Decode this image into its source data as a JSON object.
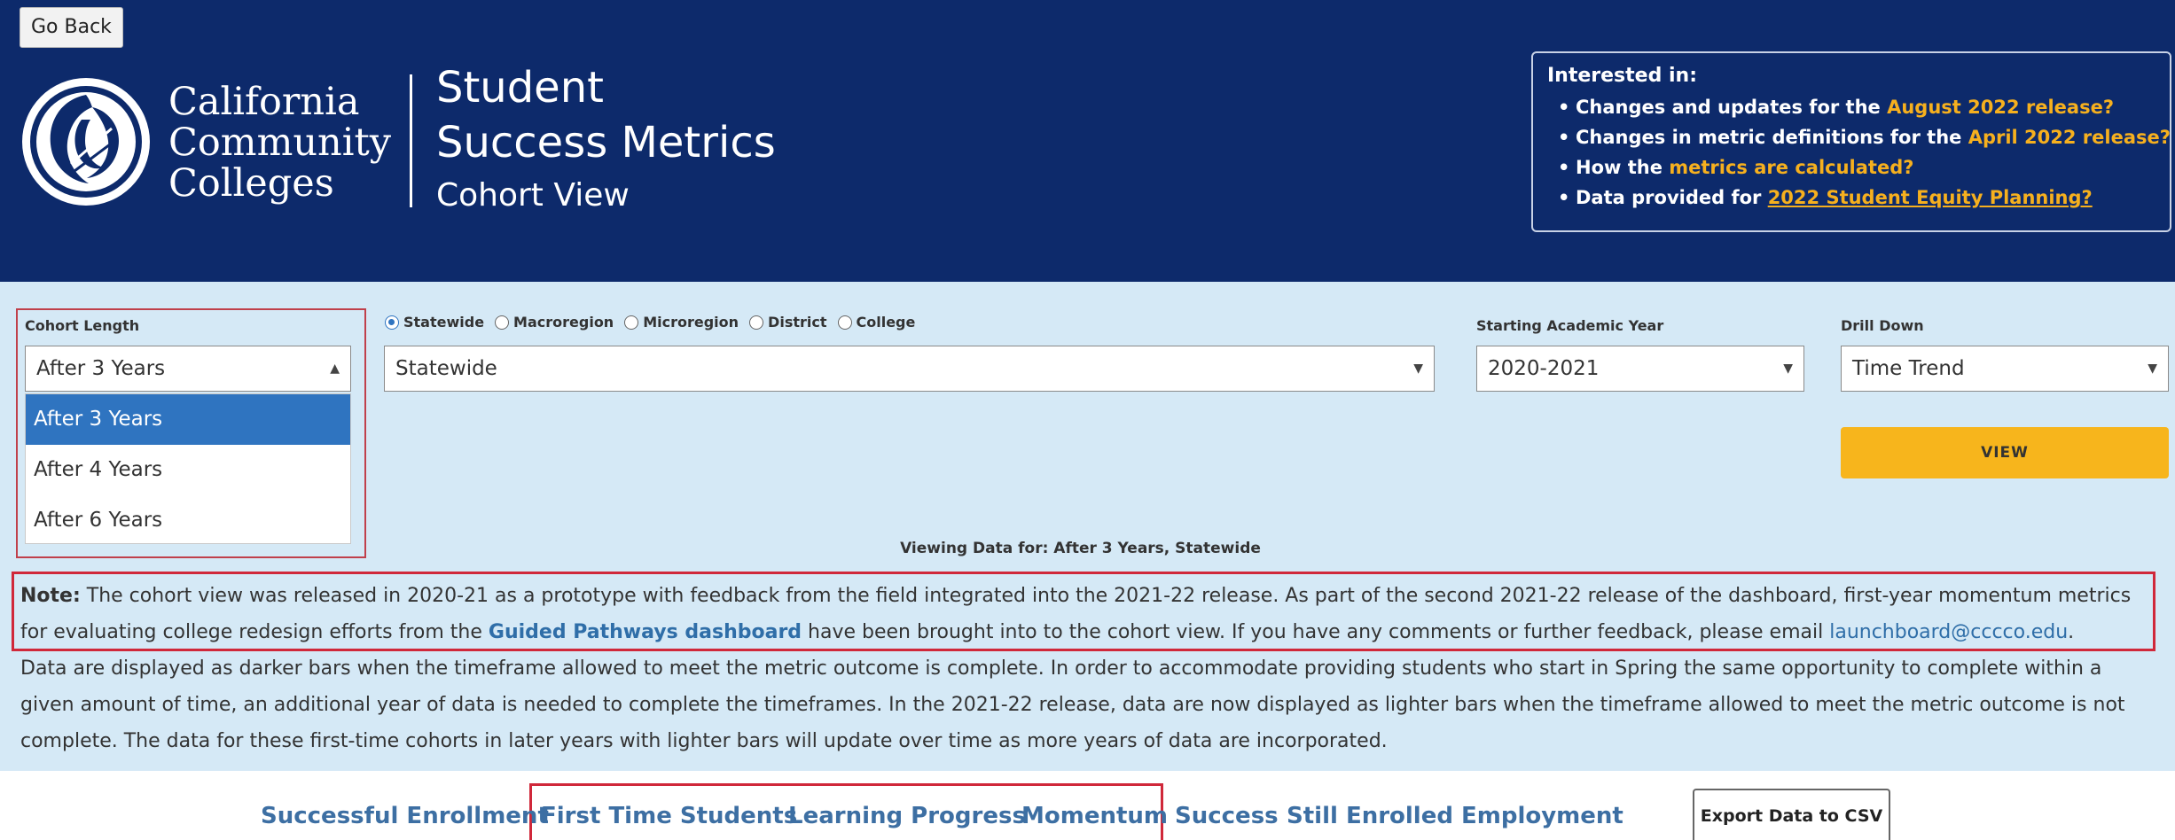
{
  "header": {
    "go_back": "Go Back",
    "logo_lines": [
      "California",
      "Community",
      "Colleges"
    ],
    "title_line1": "Student",
    "title_line2": "Success Metrics",
    "title_line3": "Cohort View",
    "interest": {
      "title": "Interested in:",
      "items": [
        {
          "prefix": "Changes and updates for the ",
          "link": "August 2022 release?"
        },
        {
          "prefix": "Changes in metric definitions for the ",
          "link": "April 2022 release?"
        },
        {
          "prefix": "How the ",
          "link": "metrics are calculated?"
        },
        {
          "prefix": "Data provided for ",
          "link": "2022 Student Equity Planning?"
        }
      ]
    },
    "colors": {
      "background": "#0d2a6b",
      "link": "#f6b01e"
    }
  },
  "filters": {
    "cohort_length": {
      "label": "Cohort Length",
      "selected": "After 3 Years",
      "options": [
        "After 3 Years",
        "After 4 Years",
        "After 6 Years"
      ]
    },
    "geography": {
      "options": [
        "Statewide",
        "Macroregion",
        "Microregion",
        "District",
        "College"
      ],
      "checked": "Statewide",
      "selected": "Statewide"
    },
    "starting_year": {
      "label": "Starting Academic Year",
      "selected": "2020-2021"
    },
    "drill_down": {
      "label": "Drill Down",
      "selected": "Time Trend"
    },
    "view_button": "VIEW",
    "viewing": "Viewing Data for: After 3 Years, Statewide",
    "colors": {
      "panel": "#d5e9f6",
      "view_button": "#f7b51c",
      "highlight": "#d0283a"
    }
  },
  "note": {
    "label": "Note:",
    "line1": "The cohort view was released in 2020-21 as a prototype with feedback from the field integrated into the 2021-22 release. As part of the second 2021-22 release of the dashboard, first-year momentum metrics",
    "line2_prefix": "for evaluating college redesign efforts from the ",
    "line2_link": "Guided Pathways dashboard",
    "line2_mid": " have been brought into to the cohort view. If you have any comments or further feedback, please email ",
    "line2_email": "launchboard@cccco.edu",
    "line2_end": ".",
    "line3": "Data are displayed as darker bars when the timeframe allowed to meet the metric outcome is complete. In order to accommodate providing students who start in Spring the same opportunity to complete within a",
    "line4": "given amount of time, an additional year of data is needed to complete the timeframes. In the 2021-22 release, data are now displayed as lighter bars when the timeframe allowed to meet the metric outcome is not",
    "line5": "complete. The data for these first-time cohorts in later years with lighter bars will update over time as more years of data are incorporated."
  },
  "tabs": [
    "Successful Enrollment",
    "First Time Students",
    "Learning Progress",
    "Momentum",
    "Success",
    "Still Enrolled",
    "Employment"
  ],
  "export_button": "Export Data to CSV"
}
